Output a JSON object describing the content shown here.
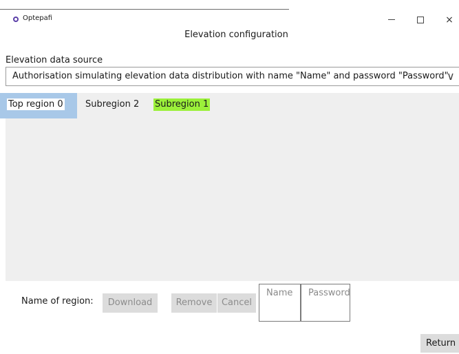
{
  "window": {
    "app_name": "Optepafi",
    "minimize_glyph": "–",
    "maximize_glyph": "□",
    "close_glyph": "×"
  },
  "dialog": {
    "title": "Elevation configuration"
  },
  "elevation_source": {
    "label": "Elevation data source",
    "selected": "Authorisation simulating elevation data distribution with name \"Name\" and password \"Password\"",
    "chevron": "∨"
  },
  "regions": {
    "items": [
      {
        "label": "Top region 0",
        "state": "selected"
      },
      {
        "label": "Subregion 2",
        "state": "normal"
      },
      {
        "label": "Subregion 1",
        "state": "highlighted"
      }
    ],
    "selected_color": "#a8c8e8",
    "highlight_color": "#9bf03a"
  },
  "region_actions": {
    "name_label": "Name of region:",
    "download_label": "Download",
    "remove_label": "Remove",
    "cancel_label": "Cancel",
    "name_placeholder": "Name",
    "password_placeholder": "Password"
  },
  "footer": {
    "return_label": "Return"
  }
}
